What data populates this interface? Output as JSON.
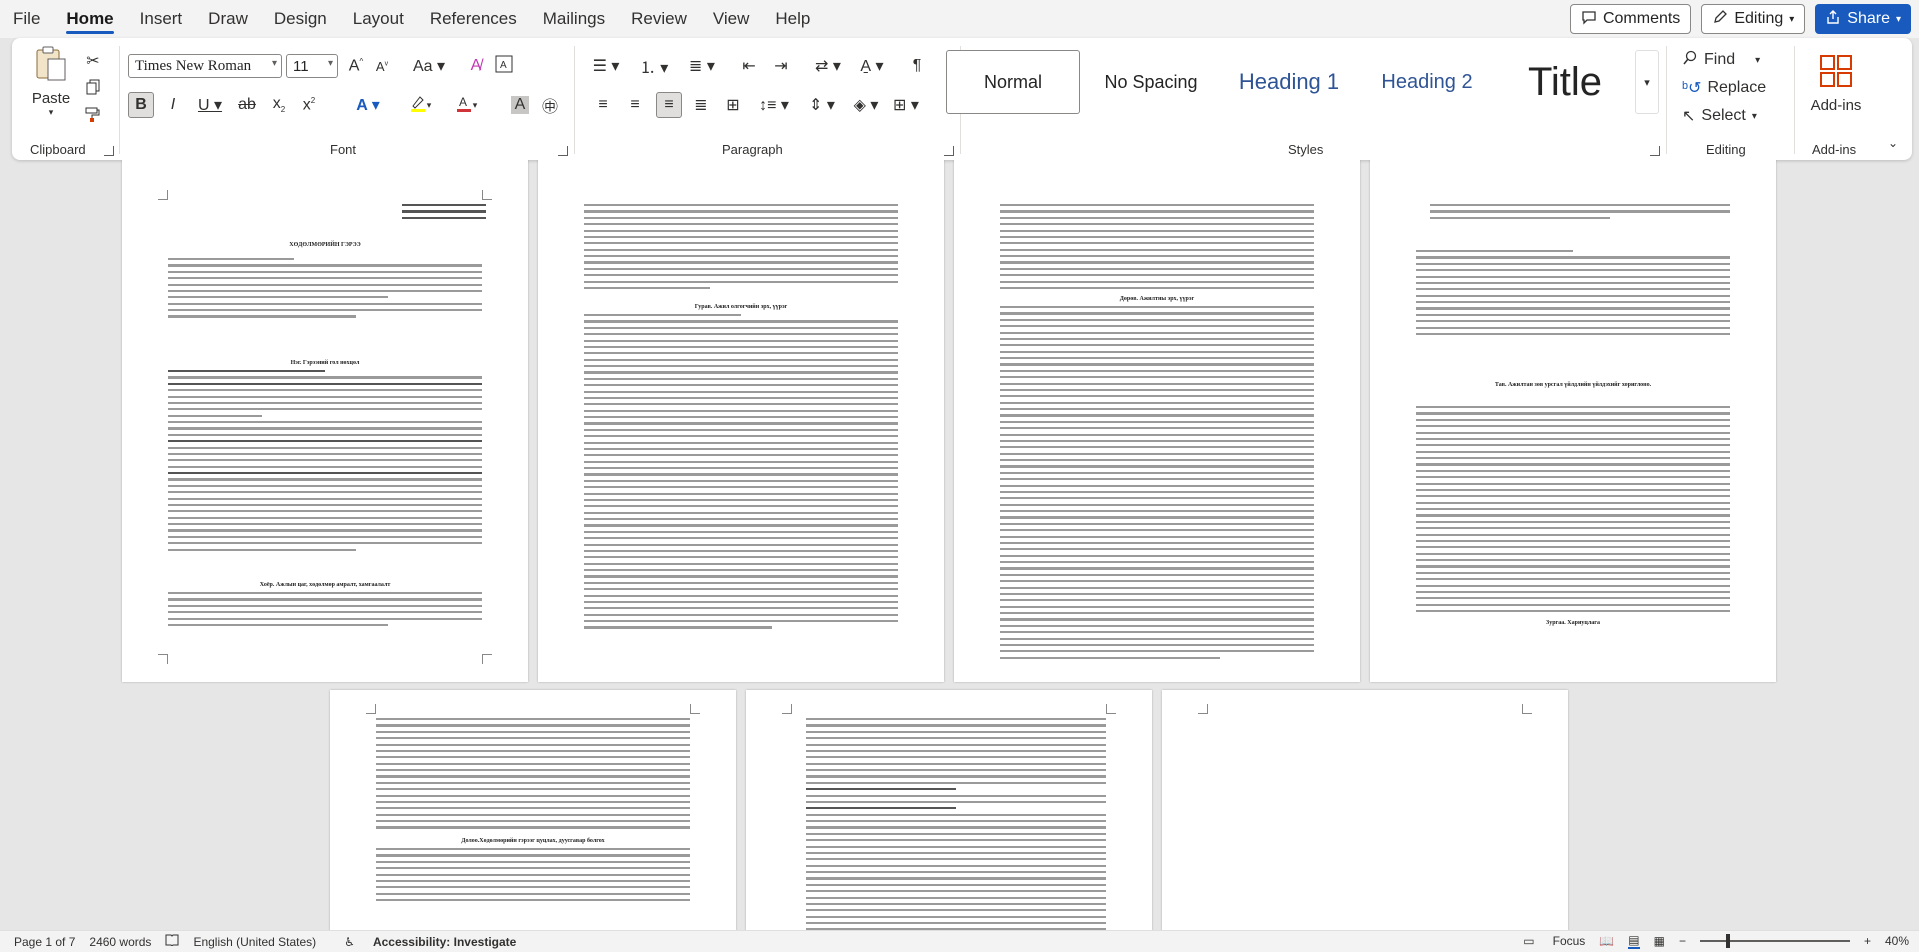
{
  "menu": {
    "items": [
      "File",
      "Home",
      "Insert",
      "Draw",
      "Design",
      "Layout",
      "References",
      "Mailings",
      "Review",
      "View",
      "Help"
    ],
    "active": "Home",
    "comments_label": "Comments",
    "editing_label": "Editing",
    "share_label": "Share"
  },
  "ribbon": {
    "clipboard": {
      "label": "Clipboard",
      "paste_label": "Paste"
    },
    "font": {
      "label": "Font",
      "font_name": "Times New Roman",
      "font_size": "11"
    },
    "paragraph": {
      "label": "Paragraph"
    },
    "styles": {
      "label": "Styles",
      "items": [
        "Normal",
        "No Spacing",
        "Heading 1",
        "Heading 2",
        "Title"
      ]
    },
    "editing": {
      "label": "Editing",
      "find": "Find",
      "replace": "Replace",
      "select": "Select"
    },
    "addins": {
      "label": "Add-ins",
      "button": "Add-ins"
    }
  },
  "document": {
    "page1": {
      "heading": "ХӨДӨЛМӨРИЙН ГЭРЭЭ",
      "section1": "Нэг. Гэрээний гол нөхцөл",
      "section2": "Хоёр. Ажлын цаг, хөдөлмөр амралт, хамгаалалт"
    },
    "page2": {
      "section": "Гурав. Ажил олгогчийн эрх, үүрэг"
    },
    "page3": {
      "section": "Дөрөв. Ажилтны эрх, үүрэг"
    },
    "page4": {
      "section1": "Тав. Ажилтан зөв урсгал үйлдлийн үйлдэхийг хориглоно.",
      "section2": "Зургаа. Хариуцлага"
    },
    "page5": {
      "section": "Долоо.Хөдөлмөрийн гэрээг цуцлах, дуусгавар болгох"
    }
  },
  "status": {
    "page": "Page 1 of 7",
    "words": "2460 words",
    "language": "English (United States)",
    "accessibility": "Accessibility: Investigate",
    "focus": "Focus",
    "zoom": "40%"
  },
  "colors": {
    "accent": "#185abd",
    "highlight": "#ffff00",
    "font_color": "#d13438",
    "addins": "#d83b01"
  }
}
